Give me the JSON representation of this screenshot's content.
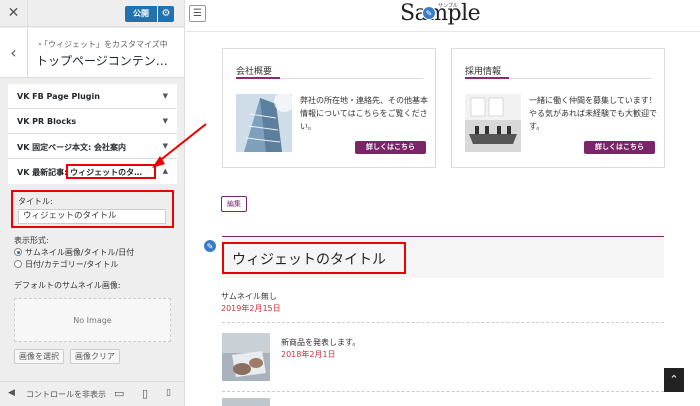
{
  "customizer": {
    "close_glyph": "✕",
    "publish_label": "公開",
    "gear_glyph": "⚙",
    "back_glyph": "‹",
    "breadcrumb": "・「ウィジェット」をカスタマイズ中",
    "section_title": "トップページコンテン…",
    "widgets": [
      {
        "label": "VK FB Page Plugin",
        "arrow": "▼"
      },
      {
        "label": "VK PR Blocks",
        "arrow": "▼"
      },
      {
        "label": "VK 固定ページ本文: 会社案内",
        "arrow": "▼"
      },
      {
        "label": "VK 最新記事: ウィジェットのタ…",
        "arrow": "▲"
      }
    ],
    "form": {
      "title_label": "タイトル:",
      "title_value": "ウィジェットのタイトル",
      "format_label": "表示形式:",
      "format_options": [
        {
          "label": "サムネイル画像/タイトル/日付",
          "checked": true
        },
        {
          "label": "日付/カテゴリー/タイトル",
          "checked": false
        }
      ],
      "thumbnail_label": "デフォルトのサムネイル画像:",
      "no_image": "No Image",
      "select_image_button": "画像を選択",
      "clear_image_button": "画像クリア"
    },
    "footer": {
      "hide_controls_glyph": "◀",
      "hide_controls_label": "コントロールを非表示",
      "device_desktop_glyph": "▭",
      "device_tablet_glyph": "▯",
      "device_mobile_glyph": "▯"
    }
  },
  "preview": {
    "menu_glyph": "☰",
    "logo": "Sample",
    "logo_sub": "サンプル",
    "pencil_glyph": "✎",
    "cards": [
      {
        "title": "会社概要",
        "text": "弊社の所在地・連絡先、その他基本情報についてはこちらをご覧ください。",
        "button": "詳しくはこちら"
      },
      {
        "title": "採用情報",
        "text": "一緒に働く仲間を募集しています！やる気があれば未経験でも大歓迎です。",
        "button": "詳しくはこちら"
      }
    ],
    "edit_button": "編集",
    "widget_title": "ウィジェットのタイトル",
    "posts": [
      {
        "title": "サムネイル無し",
        "date": "2019年2月15日"
      },
      {
        "title": "新商品を発表します。",
        "date": "2018年2月1日"
      }
    ],
    "scroll_top_glyph": "⌃"
  },
  "colors": {
    "accent": "#7a2567",
    "date": "#c7333f",
    "highlight": "#ee0000",
    "publish": "#2271b1"
  }
}
